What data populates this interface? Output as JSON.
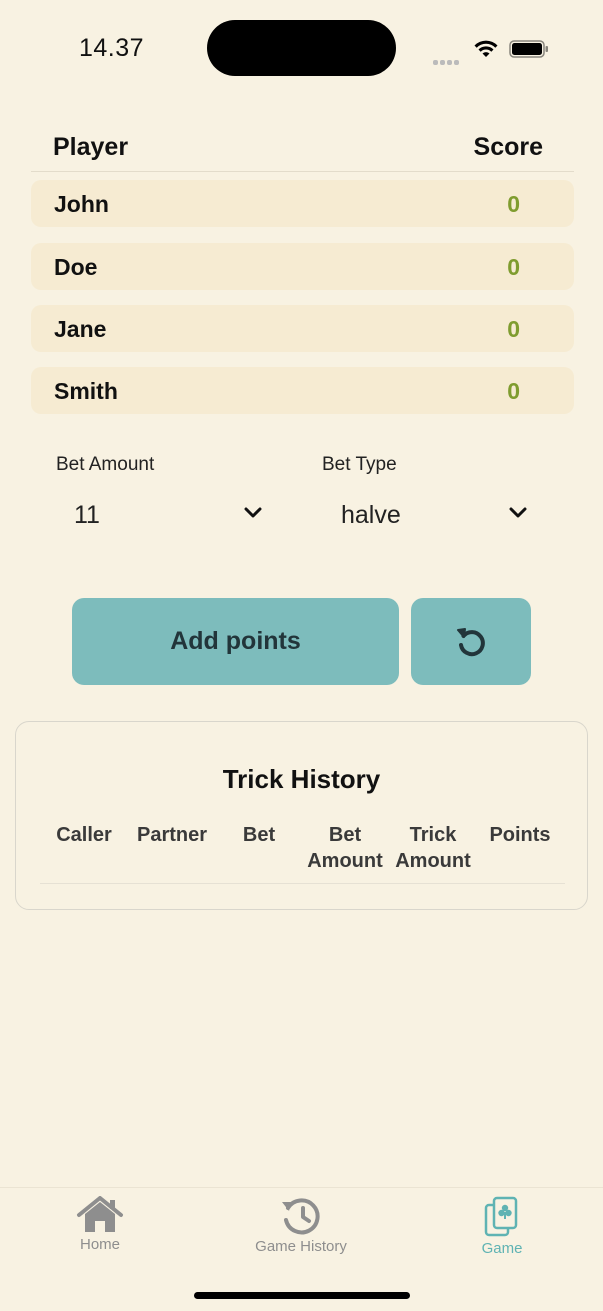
{
  "status_bar": {
    "time": "14.37"
  },
  "table": {
    "header_player": "Player",
    "header_score": "Score",
    "players": [
      {
        "name": "John",
        "score": "0"
      },
      {
        "name": "Doe",
        "score": "0"
      },
      {
        "name": "Jane",
        "score": "0"
      },
      {
        "name": "Smith",
        "score": "0"
      }
    ]
  },
  "bet": {
    "amount_label": "Bet Amount",
    "amount_value": "11",
    "type_label": "Bet Type",
    "type_value": "halve"
  },
  "actions": {
    "add_points": "Add points"
  },
  "history": {
    "title": "Trick History",
    "columns": [
      {
        "line1": "Caller",
        "line2": ""
      },
      {
        "line1": "Partner",
        "line2": ""
      },
      {
        "line1": "Bet",
        "line2": ""
      },
      {
        "line1": "Bet",
        "line2": "Amount"
      },
      {
        "line1": "Trick",
        "line2": "Amount"
      },
      {
        "line1": "Points",
        "line2": ""
      }
    ]
  },
  "tabs": [
    {
      "label": "Home",
      "icon": "house-icon",
      "active": false
    },
    {
      "label": "Game History",
      "icon": "history-icon",
      "active": false
    },
    {
      "label": "Game",
      "icon": "cards-icon",
      "active": true
    }
  ],
  "colors": {
    "background": "#f8f2e2",
    "row": "#f6ebd2",
    "score": "#7f9c2f",
    "button": "#7dbcbc",
    "tab_active": "#5fb3b3",
    "tab_inactive": "#8e8e8e"
  }
}
